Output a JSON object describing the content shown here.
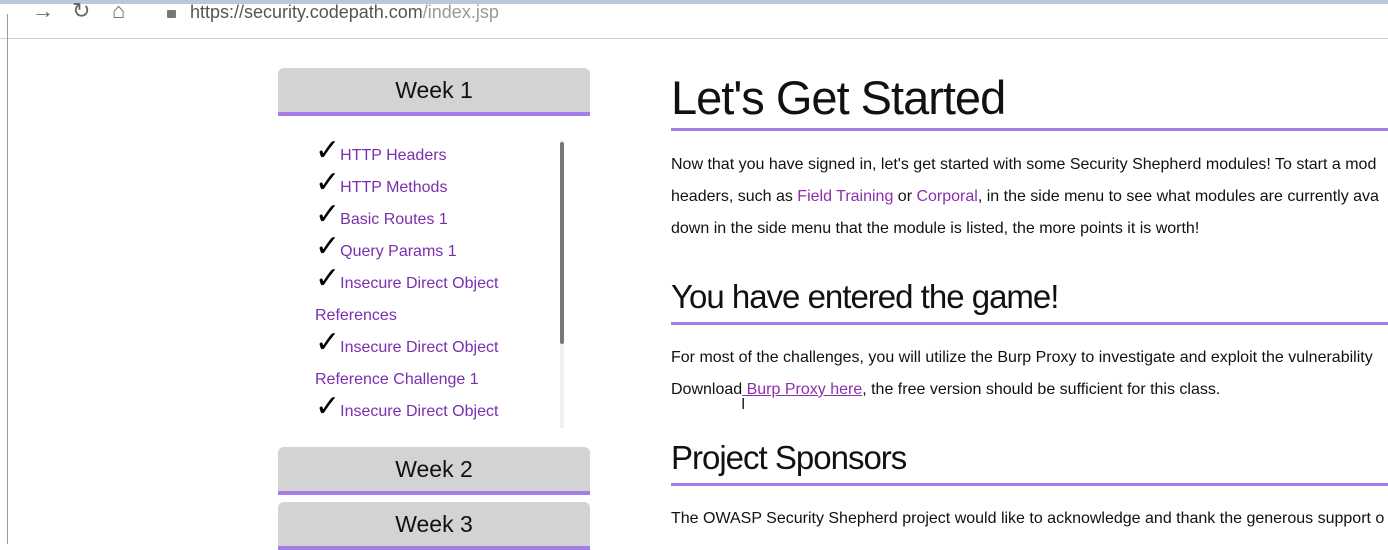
{
  "browser": {
    "url_host": "https://security.codepath.com",
    "url_path": "/index.jsp",
    "forward_icon": "arrow-right-icon",
    "reload_icon": "reload-icon",
    "home_icon": "home-icon",
    "lock_icon": "lock-icon"
  },
  "colors": {
    "accent": "#a57ce8",
    "link": "#8b2fae",
    "week_button_bg": "#d3d3d3"
  },
  "sidebar": {
    "week1": "Week 1",
    "week2": "Week 2",
    "week3": "Week 3",
    "check": "✓",
    "items": [
      {
        "label": "HTTP Headers"
      },
      {
        "label": "HTTP Methods"
      },
      {
        "label": "Basic Routes 1"
      },
      {
        "label": "Query Params 1"
      },
      {
        "label": "Insecure Direct Object References"
      },
      {
        "label": "Insecure Direct Object Reference Challenge 1"
      },
      {
        "label": "Insecure Direct Object"
      }
    ]
  },
  "main": {
    "title": "Let's Get Started",
    "intro": {
      "line1": "Now that you have signed in, let's get started with some Security Shepherd modules! To start a mod",
      "line2_pre": "headers, such as ",
      "link_field_training": "Field Training",
      "line2_or": " or ",
      "link_corporal": "Corporal",
      "line2_post": ", in the side menu to see what modules are currently ava",
      "line3": "down in the side menu that the module is listed, the more points it is worth!"
    },
    "section2_title": "You have entered the game!",
    "section2": {
      "line1": "For most of the challenges, you will utilize the Burp Proxy to investigate and exploit the vulnerability",
      "line2_pre": "Download",
      "link_burp": " Burp Proxy here",
      "line2_post": ", the free version should be sufficient for this class."
    },
    "section3_title": "Project Sponsors",
    "section3": {
      "line1": "The OWASP Security Shepherd project would like to acknowledge and thank the generous support o"
    },
    "text_cursor": "I"
  }
}
